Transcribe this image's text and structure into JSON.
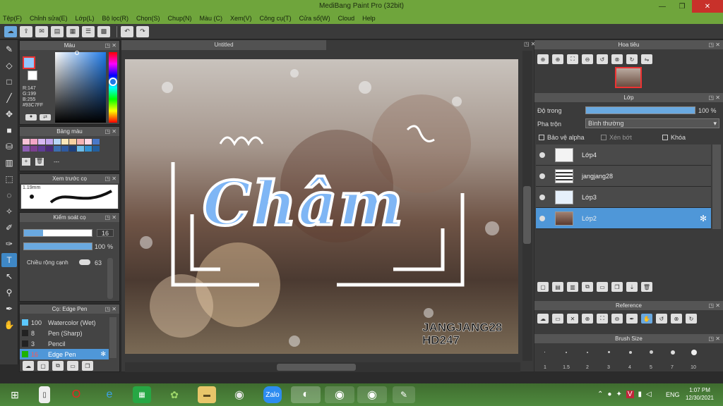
{
  "window": {
    "title": "MediBang Paint Pro (32bit)",
    "minimize": "—",
    "restore": "❐",
    "close": "✕"
  },
  "menu": [
    "Tệp(F)",
    "Chỉnh sửa(E)",
    "Lớp(L)",
    "Bộ lọc(R)",
    "Chọn(S)",
    "Chup(N)",
    "Màu (C)",
    "Xem(V)",
    "Công cụ(T)",
    "Cửa sổ(W)",
    "Cloud",
    "Help"
  ],
  "toolbar": {
    "undo": "↶",
    "redo": "↷"
  },
  "color_panel": {
    "title": "Màu",
    "r": "R:147",
    "g": "G:199",
    "b": "B:255",
    "hex": "#93C7FF",
    "primary_color": "#93C7FF"
  },
  "palette_panel": {
    "title": "Bảng màu",
    "placeholder": "---"
  },
  "brush_preview": {
    "title": "Xem trước cọ",
    "size": "1.19mm"
  },
  "brush_control": {
    "title": "Kiểm soát cọ",
    "size_value": "16",
    "opacity_value": "100",
    "opacity_unit": "%",
    "width_label": "Chiều rộng cạnh",
    "width_value": "63"
  },
  "brush_list": {
    "title": "Cọ: Edge Pen",
    "items": [
      {
        "size": "100",
        "name": "Watercolor (Wet)",
        "color": "#5cc8ff"
      },
      {
        "size": "8",
        "name": "Pen (Sharp)",
        "color": "#222222"
      },
      {
        "size": "3",
        "name": "Pencil",
        "color": "#222222"
      },
      {
        "size": "16",
        "name": "Edge Pen",
        "color": "#1db300"
      }
    ]
  },
  "canvas": {
    "tab": "Untitled",
    "title_art": "Châm",
    "watermark_line1": "JANGJANG28",
    "watermark_line2": "HD247"
  },
  "navigator": {
    "title": "Hoa tiêu"
  },
  "layers_panel": {
    "title": "Lớp",
    "opacity_label": "Độ trong",
    "opacity_value": "100 %",
    "blend_label": "Pha trộn",
    "blend_value": "Bình thường",
    "protect_alpha": "Bảo vệ alpha",
    "clipping": "Xén bớt",
    "lock": "Khóa",
    "layers": [
      {
        "name": "Lớp4"
      },
      {
        "name": "jangjang28"
      },
      {
        "name": "Lớp3"
      },
      {
        "name": "Lớp2"
      }
    ]
  },
  "reference_panel": {
    "title": "Reference"
  },
  "brush_size_panel": {
    "title": "Brush Size",
    "sizes": [
      "1",
      "1.5",
      "2",
      "3",
      "4",
      "5",
      "7",
      "10"
    ]
  },
  "taskbar": {
    "lang": "ENG",
    "time": "1:07 PM",
    "date": "12/30/2021"
  },
  "colors": {
    "accent": "#4f97d8",
    "titlebar": "#6fa53c",
    "close": "#c8312a",
    "art_blue": "#7fb6f5"
  }
}
